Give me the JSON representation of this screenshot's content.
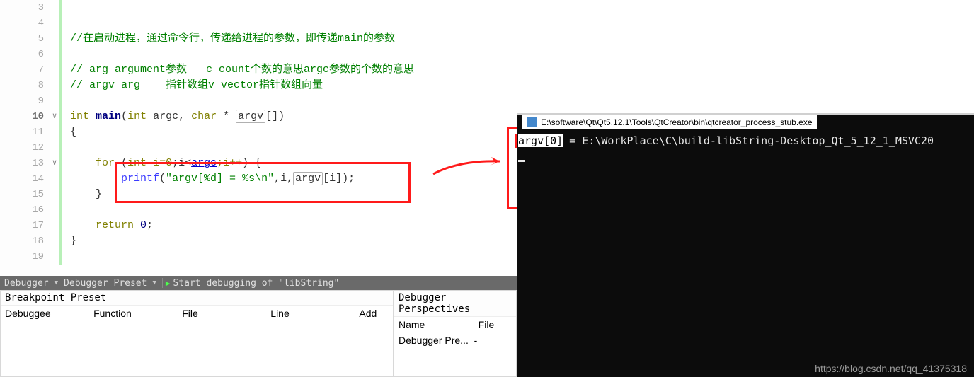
{
  "code": {
    "lines": [
      3,
      4,
      5,
      6,
      7,
      8,
      9,
      10,
      11,
      12,
      13,
      14,
      15,
      16,
      17,
      18,
      19
    ],
    "current_line": 10,
    "l4": "//在启动进程，通过命令行，传递给进程的参数，即传递main的参数",
    "l7": "// arg argument参数   c count个数的意思argc参数的个数的意思",
    "l8": "// argv arg    指针数组v vector指针数组向量",
    "l10_int": "int",
    "l10_main": "main",
    "l10_open": "(",
    "l10_int2": "int",
    "l10_argc": " argc, ",
    "l10_char": "char",
    "l10_star": " * ",
    "l10_argv": "argv",
    "l10_brack": "[])",
    "l11": "{",
    "l13_for": "for",
    "l13a": " (",
    "l13_int": "int",
    "l13_idecl": " i=0",
    "l13b": ";i<",
    "l13_argc": "argc",
    "l13c": ";i++",
    "l13d": ") {",
    "l14_printf": "printf",
    "l14_open": "(",
    "l14_str": "\"argv[%d] = %s\\n\"",
    "l14_mid": ",i,",
    "l14_argv": "argv",
    "l14_end": "[i]);",
    "l15": "}",
    "l17_return": "return",
    "l17_sp": " ",
    "l17_zero": "0",
    "l17_semi": ";",
    "l18": "}"
  },
  "debugger_bar": {
    "label": "Debugger",
    "preset": "Debugger Preset",
    "start": "Start debugging of \"libString\""
  },
  "breakpoint_panel": {
    "title": "Breakpoint Preset",
    "cols": [
      "Debuggee",
      "Function",
      "File",
      "Line",
      "Add"
    ]
  },
  "perspectives_panel": {
    "title": "Debugger Perspectives",
    "cols": [
      "Name",
      "File"
    ],
    "row_name": "Debugger Pre...",
    "row_file": "-"
  },
  "console": {
    "title": "E:\\software\\Qt\\Qt5.12.1\\Tools\\QtCreator\\bin\\qtcreator_process_stub.exe",
    "out_prefix": "argv[0]",
    "out_rest": " = E:\\WorkPlace\\C\\build-libString-Desktop_Qt_5_12_1_MSVC20"
  },
  "watermark": "https://blog.csdn.net/qq_41375318"
}
